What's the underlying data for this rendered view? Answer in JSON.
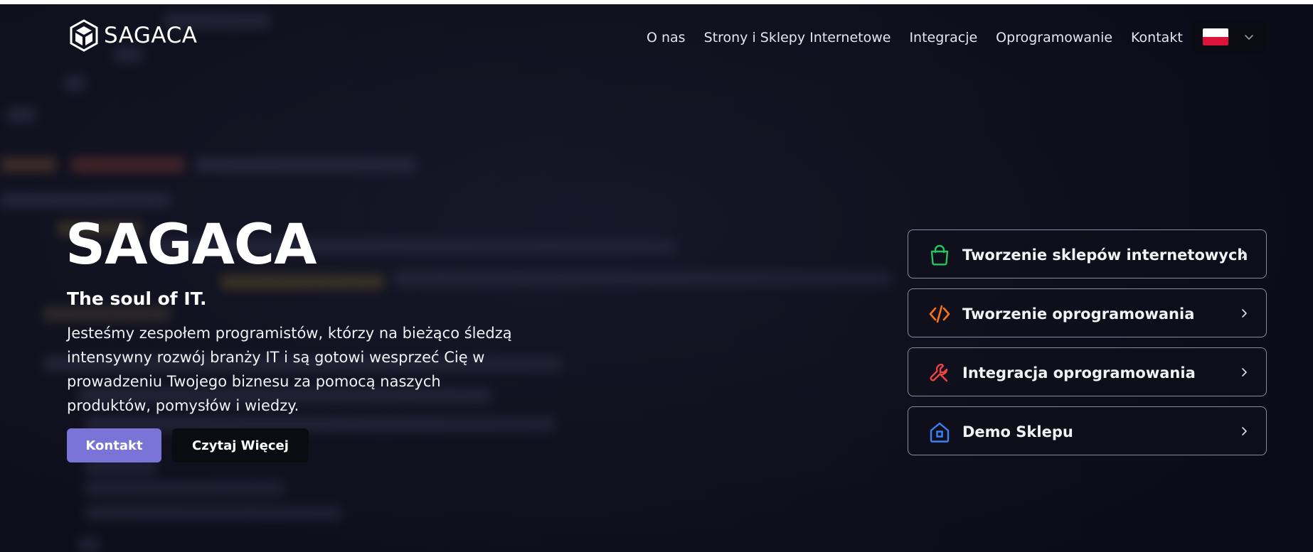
{
  "brand": {
    "logo_text": "SAGACA",
    "logo_icon": "cube-logo-icon"
  },
  "nav": {
    "items": [
      {
        "label": "O nas"
      },
      {
        "label": "Strony i Sklepy Internetowe"
      },
      {
        "label": "Integracje"
      },
      {
        "label": "Oprogramowanie"
      },
      {
        "label": "Kontakt"
      }
    ],
    "language": {
      "flag_icon": "poland-flag-icon",
      "chevron_icon": "chevron-down-icon"
    }
  },
  "hero": {
    "title": "SAGACA",
    "subtitle": "The soul of IT.",
    "description": "Jesteśmy zespołem programistów, którzy na bieżąco śledzą intensywny rozwój branży IT i są gotowi wesprzeć Cię w prowadzeniu Twojego biznesu za pomocą naszych produktów, pomysłów i wiedzy.",
    "primary_button": "Kontakt",
    "secondary_button": "Czytaj Więcej"
  },
  "services": [
    {
      "label": "Tworzenie sklepów internetowych",
      "icon": "shopping-bag-icon",
      "color": "#22c55e"
    },
    {
      "label": "Tworzenie oprogramowania",
      "icon": "code-icon",
      "color": "#f97316"
    },
    {
      "label": "Integracja oprogramowania",
      "icon": "wrench-icon",
      "color": "#ef4444"
    },
    {
      "label": "Demo Sklepu",
      "icon": "house-icon",
      "color": "#3b82f6"
    }
  ],
  "colors": {
    "accent": "#7a74d8",
    "background": "#141424",
    "card_border": "#8a8aa0"
  }
}
